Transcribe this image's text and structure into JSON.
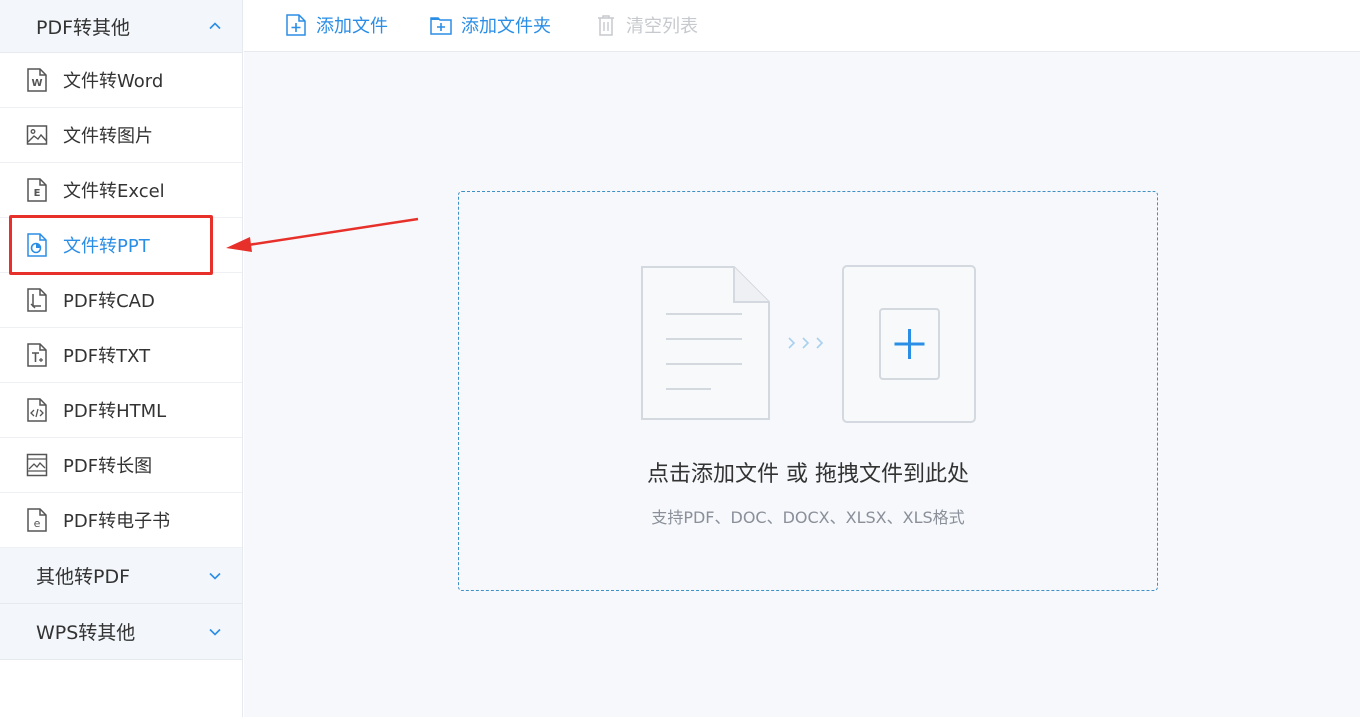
{
  "sidebar": {
    "group1": {
      "label": "PDF转其他"
    },
    "items": [
      {
        "label": "文件转Word",
        "icon": "word-doc-icon"
      },
      {
        "label": "文件转图片",
        "icon": "image-icon"
      },
      {
        "label": "文件转Excel",
        "icon": "excel-doc-icon"
      },
      {
        "label": "文件转PPT",
        "icon": "ppt-doc-icon",
        "active": true
      },
      {
        "label": "PDF转CAD",
        "icon": "cad-doc-icon"
      },
      {
        "label": "PDF转TXT",
        "icon": "txt-doc-icon"
      },
      {
        "label": "PDF转HTML",
        "icon": "html-doc-icon"
      },
      {
        "label": "PDF转长图",
        "icon": "long-image-icon"
      },
      {
        "label": "PDF转电子书",
        "icon": "ebook-icon"
      }
    ],
    "group2": {
      "label": "其他转PDF"
    },
    "group3": {
      "label": "WPS转其他"
    }
  },
  "toolbar": {
    "add_file": "添加文件",
    "add_folder": "添加文件夹",
    "clear_list": "清空列表"
  },
  "dropzone": {
    "title": "点击添加文件 或 拖拽文件到此处",
    "subtitle": "支持PDF、DOC、DOCX、XLSX、XLS格式"
  },
  "colors": {
    "accent": "#2b8ee6",
    "highlight": "#e8302a",
    "sidebar_header_bg": "#f3f6fa",
    "main_bg": "#f6f8fb"
  }
}
